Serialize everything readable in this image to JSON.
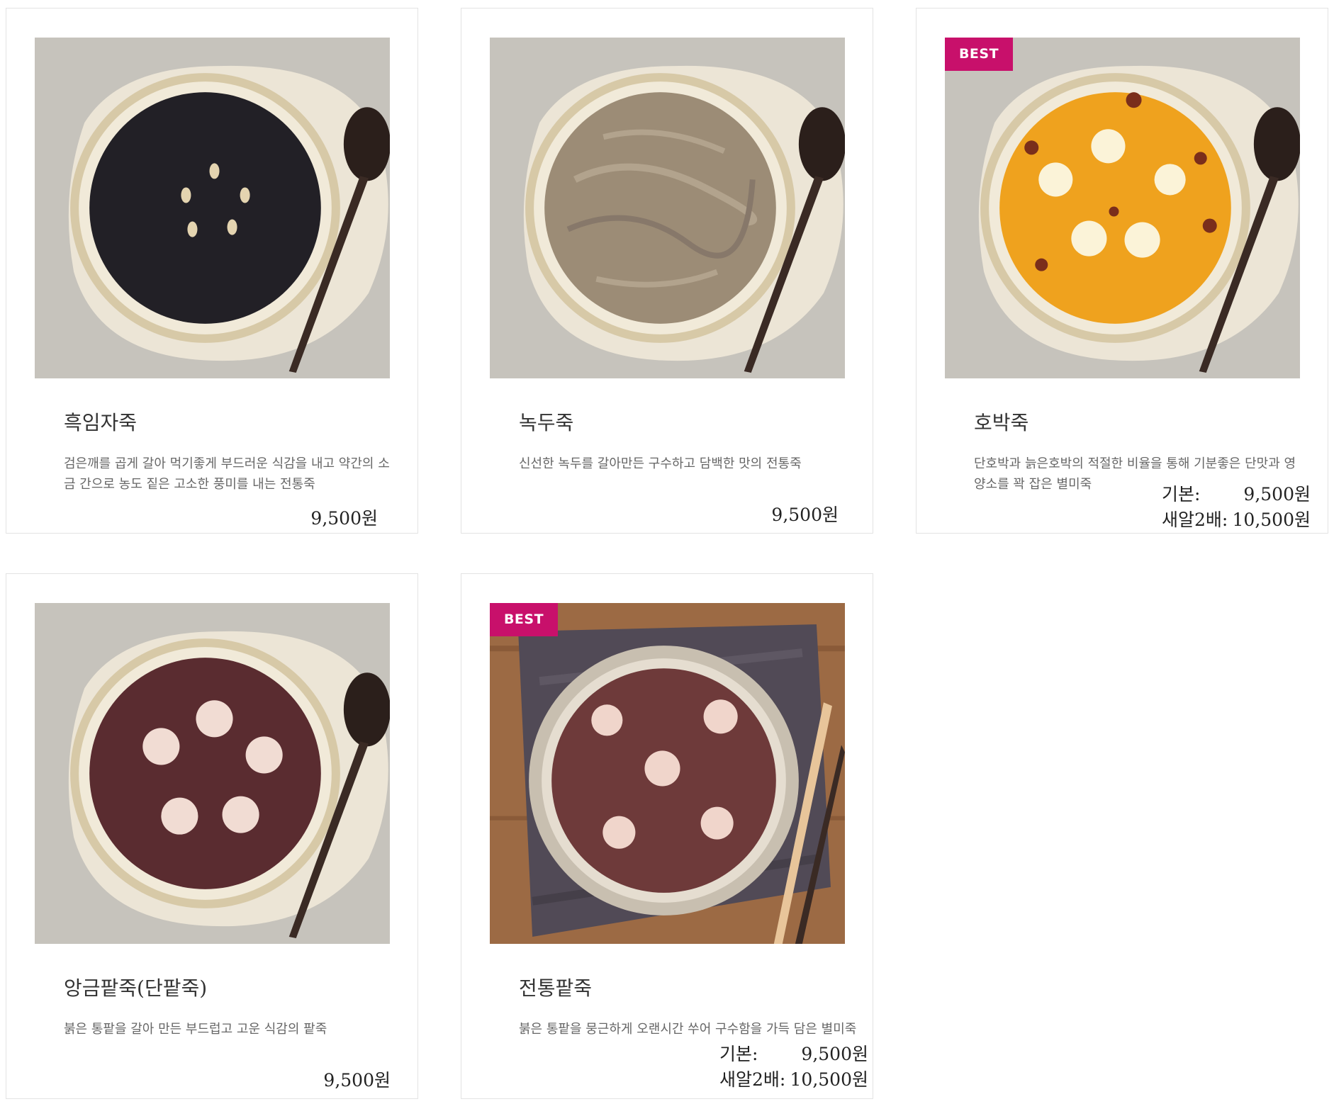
{
  "badge_label": "BEST",
  "colors": {
    "badge": "#c8106b",
    "card_border": "#e3e3e3"
  },
  "products": [
    {
      "name": "흑임자죽",
      "description": "검은깨를 곱게 갈아 먹기좋게 부드러운 식감을 내고 약간의 소금 간으로 농도 짙은 고소한 풍미를 내는 전통죽",
      "price": "9,500원",
      "best": false,
      "image": "black-sesame-porridge-photo"
    },
    {
      "name": "녹두죽",
      "description": "신선한 녹두를 갈아만든 구수하고 담백한 맛의 전통죽",
      "price": "9,500원",
      "best": false,
      "image": "mung-bean-porridge-photo"
    },
    {
      "name": "호박죽",
      "description": "단호박과 늙은호박의 적절한 비율을 통해 기분좋은 단맛과 영양소를 꽉 잡은 별미죽",
      "price_basic_label": "기본:",
      "price_basic": "9,500원",
      "price_extra_label": "새알2배:",
      "price_extra": "10,500원",
      "best": true,
      "image": "pumpkin-porridge-photo"
    },
    {
      "name": "앙금팥죽(단팥죽)",
      "description": "붉은 통팥을 갈아 만든 부드럽고 고운 식감의 팥죽",
      "price": "9,500원",
      "best": false,
      "image": "sweet-red-bean-porridge-photo"
    },
    {
      "name": "전통팥죽",
      "description": "붉은 통팥을 뭉근하게 오랜시간 쑤어 구수함을 가득 담은 별미죽",
      "price_basic_label": "기본:",
      "price_basic": "9,500원",
      "price_extra_label": "새알2배:",
      "price_extra": "10,500원",
      "best": true,
      "image": "traditional-red-bean-porridge-photo"
    }
  ]
}
